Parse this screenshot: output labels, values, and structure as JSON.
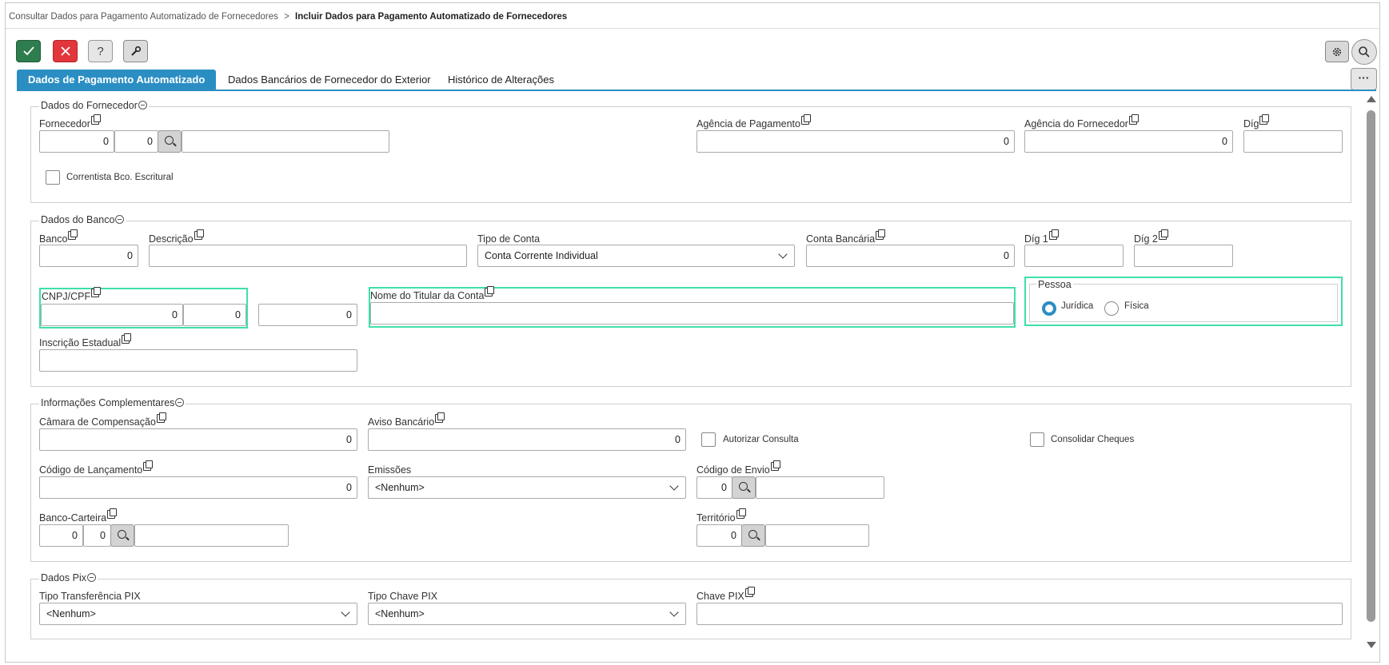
{
  "breadcrumb": {
    "parent": "Consultar Dados para Pagamento Automatizado de Fornecedores",
    "separator": ">",
    "current": "Incluir Dados para Pagamento Automatizado de Fornecedores"
  },
  "toolbar": {
    "confirm_icon": "check-icon",
    "cancel_icon": "close-icon",
    "help_label": "?",
    "tools_icon": "wrench-icon",
    "settings_icon": "gear-icon",
    "search_icon": "search-icon",
    "more_label": "···"
  },
  "tabs": [
    {
      "label": "Dados de Pagamento Automatizado",
      "active": true
    },
    {
      "label": "Dados Bancários de Fornecedor do Exterior",
      "active": false
    },
    {
      "label": "Histórico de Alterações",
      "active": false
    }
  ],
  "fornecedor": {
    "title": "Dados do Fornecedor",
    "fornecedor_label": "Fornecedor",
    "fornecedor_value1": "0",
    "fornecedor_value2": "0",
    "fornecedor_desc": "",
    "agencia_pag_label": "Agência de Pagamento",
    "agencia_pag_value": "0",
    "agencia_forn_label": "Agência do Fornecedor",
    "agencia_forn_value": "0",
    "dig_label": "Díg",
    "dig_value": "",
    "correntista_label": "Correntista Bco. Escritural"
  },
  "banco": {
    "title": "Dados do Banco",
    "banco_label": "Banco",
    "banco_value": "0",
    "descricao_label": "Descrição",
    "descricao_value": "",
    "tipo_conta_label": "Tipo de Conta",
    "tipo_conta_value": "Conta Corrente Individual",
    "conta_label": "Conta Bancária",
    "conta_value": "0",
    "dig1_label": "Díg 1",
    "dig1_value": "",
    "dig2_label": "Díg 2",
    "dig2_value": "",
    "cnpj_label": "CNPJ/CPF",
    "cnpj_value1": "0",
    "cnpj_value2": "0",
    "cnpj_value3": "0",
    "titular_label": "Nome do Titular da Conta",
    "titular_value": "",
    "pessoa_label": "Pessoa",
    "pessoa_options": [
      "Jurídica",
      "Física"
    ],
    "pessoa_selected": "Jurídica",
    "inscricao_label": "Inscrição Estadual",
    "inscricao_value": ""
  },
  "complementares": {
    "title": "Informações Complementares",
    "camara_label": "Câmara de Compensação",
    "camara_value": "0",
    "aviso_label": "Aviso Bancário",
    "aviso_value": "0",
    "autorizar_label": "Autorizar Consulta",
    "consolidar_label": "Consolidar Cheques",
    "codigo_lanc_label": "Código de Lançamento",
    "codigo_lanc_value": "0",
    "emissoes_label": "Emissões",
    "emissoes_value": "<Nenhum>",
    "codigo_envio_label": "Código de Envio",
    "codigo_envio_value": "0",
    "banco_carteira_label": "Banco-Carteira",
    "banco_carteira_value1": "0",
    "banco_carteira_value2": "0",
    "territorio_label": "Território",
    "territorio_value": "0"
  },
  "pix": {
    "title": "Dados Pix",
    "tipo_transf_label": "Tipo Transferência PIX",
    "tipo_transf_value": "<Nenhum>",
    "tipo_chave_label": "Tipo Chave PIX",
    "tipo_chave_value": "<Nenhum>",
    "chave_label": "Chave PIX",
    "chave_value": ""
  },
  "colors": {
    "accent": "#2b8ec3",
    "confirm": "#2e7d4f",
    "cancel": "#e0363c",
    "highlight": "#3ee0a8",
    "radio_selected": "#2b8ec3"
  }
}
